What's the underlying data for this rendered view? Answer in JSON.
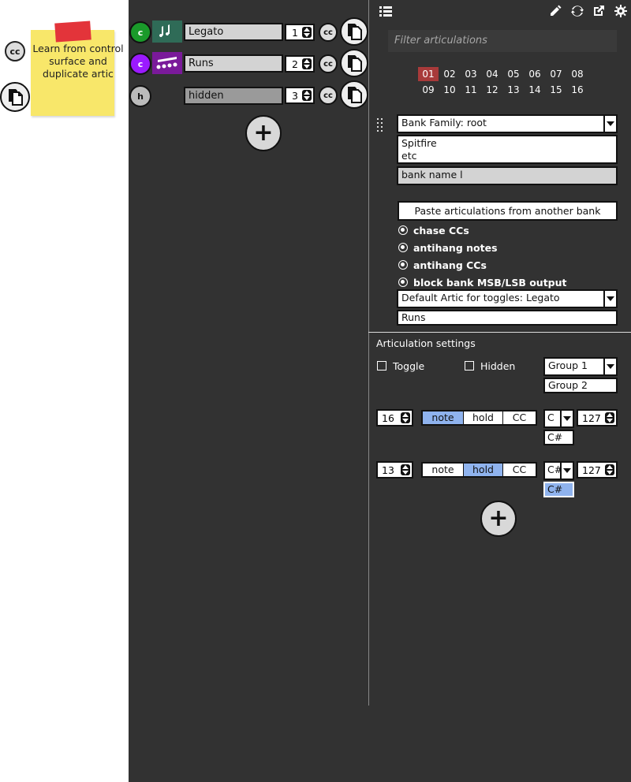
{
  "annotation": {
    "note_text": "Learn from control surface and duplicate artic",
    "cc_label": "cc"
  },
  "articulations": [
    {
      "circle_letter": "c",
      "circle_color": "#1a9a2a",
      "icon": "legato-notes-icon",
      "icon_bg": "#2f6b57",
      "name": "Legato",
      "number": "1"
    },
    {
      "circle_letter": "c",
      "circle_color": "#9b1aff",
      "icon": "runs-notes-icon",
      "icon_bg": "#7a1a9a",
      "name": "Runs",
      "number": "2"
    },
    {
      "circle_letter": "h",
      "circle_color": "#bbbbbb",
      "icon": "",
      "icon_bg": "",
      "name": "hidden",
      "number": "3"
    }
  ],
  "cc_label": "cc",
  "add_symbol": "+",
  "filter": {
    "placeholder": "Filter articulations"
  },
  "channels": [
    "01",
    "02",
    "03",
    "04",
    "05",
    "06",
    "07",
    "08",
    "09",
    "10",
    "11",
    "12",
    "13",
    "14",
    "15",
    "16"
  ],
  "selected_channel": "01",
  "bank": {
    "family": "Bank Family: root",
    "tags_line1": "Spitfire",
    "tags_line2": "etc",
    "name": "bank name l",
    "paste_button": "Paste articulations from another bank",
    "options": [
      "chase CCs",
      "antihang notes",
      "antihang CCs",
      "block bank MSB/LSB output"
    ],
    "default_artic": "Default Artic for toggles: Legato",
    "default_artic_option": "Runs"
  },
  "settings": {
    "title": "Articulation settings",
    "toggle_label": "Toggle",
    "hidden_label": "Hidden",
    "group": "Group 1",
    "group_option": "Group 2",
    "rows": [
      {
        "channel": "16",
        "modes": [
          "note",
          "hold",
          "CC"
        ],
        "active_mode": "note",
        "note": "C",
        "note_option": "C#",
        "velocity": "127"
      },
      {
        "channel": "13",
        "modes": [
          "note",
          "hold",
          "CC"
        ],
        "active_mode": "hold",
        "note": "C#",
        "note_option": "C#",
        "velocity": "127"
      }
    ]
  },
  "colors": {
    "panel_bg": "#323232",
    "selected_channel": "#a83a3a",
    "highlight": "#8fb3ee",
    "sticky": "#f8e76a"
  },
  "toolbar_icons": [
    "list-icon",
    "pencil-icon",
    "sync-icon",
    "external-link-icon",
    "gear-icon"
  ]
}
